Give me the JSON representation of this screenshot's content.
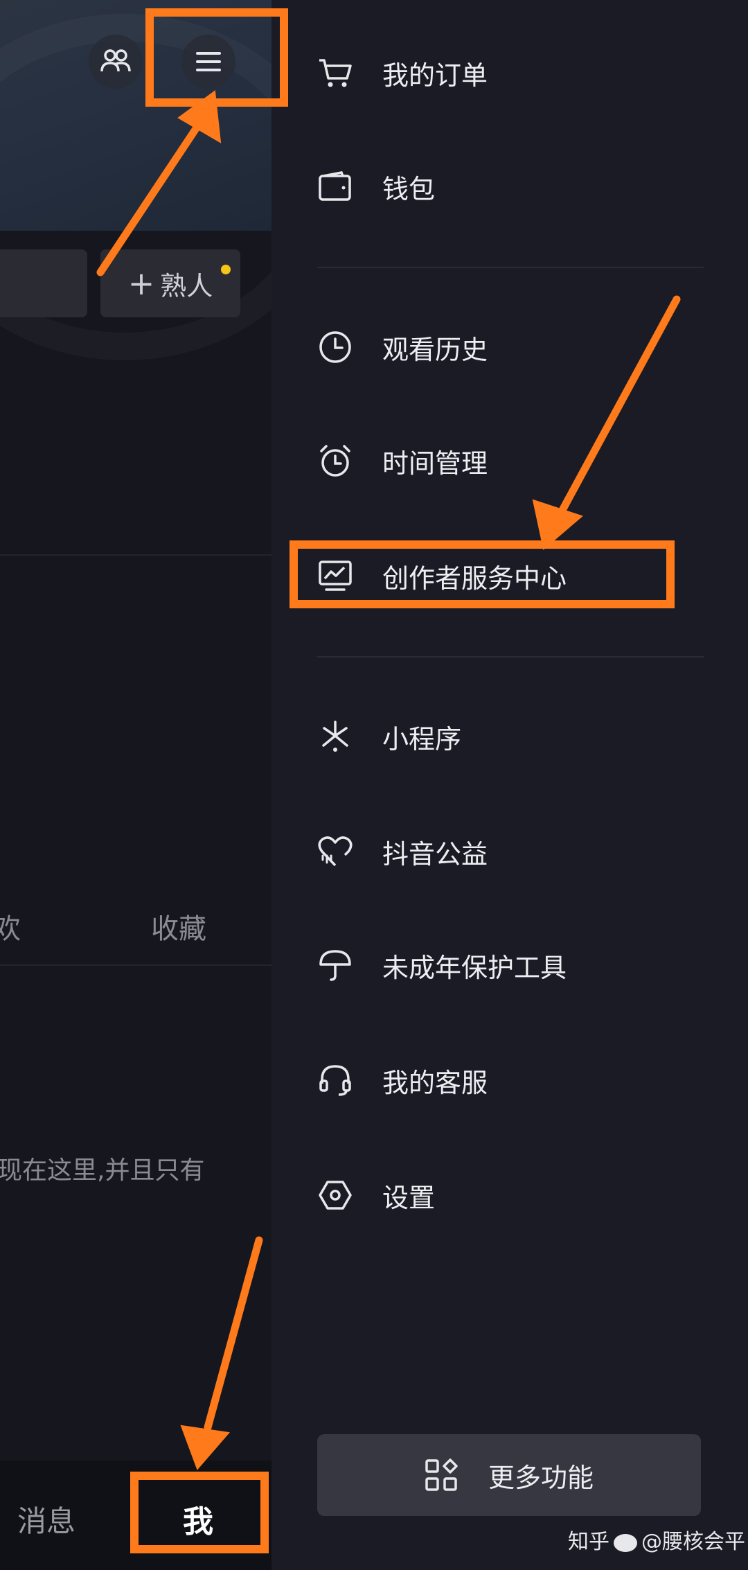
{
  "left_page": {
    "add_friend_label": "熟人",
    "tabs": {
      "like_partial": "欢",
      "favorites": "收藏"
    },
    "empty_hint": "现在这里,并且只有",
    "bottom_nav": {
      "messages": "消息",
      "me": "我"
    }
  },
  "drawer": {
    "sections": [
      [
        {
          "label": "我的订单",
          "icon": "cart-icon"
        },
        {
          "label": "钱包",
          "icon": "wallet-icon"
        }
      ],
      [
        {
          "label": "观看历史",
          "icon": "clock-icon"
        },
        {
          "label": "时间管理",
          "icon": "alarm-icon"
        },
        {
          "label": "创作者服务中心",
          "icon": "chart-monitor-icon"
        }
      ],
      [
        {
          "label": "小程序",
          "icon": "mini-program-icon"
        },
        {
          "label": "抖音公益",
          "icon": "charity-heart-icon"
        },
        {
          "label": "未成年保护工具",
          "icon": "umbrella-icon"
        },
        {
          "label": "我的客服",
          "icon": "headset-icon"
        },
        {
          "label": "设置",
          "icon": "hexagon-settings-icon"
        }
      ]
    ],
    "more_button": "更多功能"
  },
  "watermark": {
    "text_left": "知乎",
    "text_right": "@腰核会平"
  },
  "colors": {
    "highlight": "#ff7a1a",
    "background": "#1a1b24",
    "badge": "#f5c518"
  }
}
